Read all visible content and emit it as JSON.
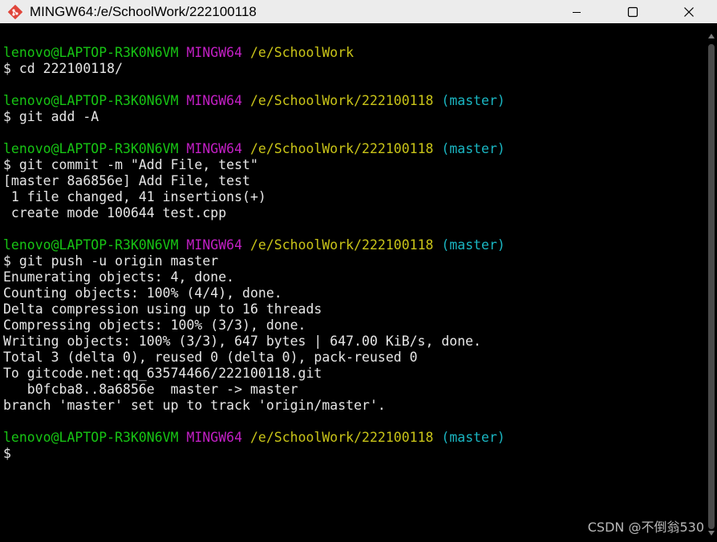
{
  "window": {
    "title": "MINGW64:/e/SchoolWork/222100118",
    "app_icon": "git-bash-icon",
    "controls": [
      {
        "name": "minimize-button",
        "icon": "minimize-icon"
      },
      {
        "name": "maximize-button",
        "icon": "maximize-icon"
      },
      {
        "name": "close-button",
        "icon": "close-icon"
      }
    ]
  },
  "colors": {
    "user_host": "#17c414",
    "system": "#c21fc4",
    "path": "#c9c418",
    "branch": "#1ab6c2",
    "text": "#e6e6e6",
    "background": "#000000"
  },
  "terminal": {
    "lines": [
      {
        "type": "prompt",
        "user": "lenovo@LAPTOP-R3K0N6VM",
        "system": "MINGW64",
        "path": "/e/SchoolWork",
        "branch": ""
      },
      {
        "type": "text",
        "text": "$ cd 222100118/"
      },
      {
        "type": "blank",
        "text": ""
      },
      {
        "type": "prompt",
        "user": "lenovo@LAPTOP-R3K0N6VM",
        "system": "MINGW64",
        "path": "/e/SchoolWork/222100118",
        "branch": "(master)"
      },
      {
        "type": "text",
        "text": "$ git add -A"
      },
      {
        "type": "blank",
        "text": ""
      },
      {
        "type": "prompt",
        "user": "lenovo@LAPTOP-R3K0N6VM",
        "system": "MINGW64",
        "path": "/e/SchoolWork/222100118",
        "branch": "(master)"
      },
      {
        "type": "text",
        "text": "$ git commit -m \"Add File, test\""
      },
      {
        "type": "text",
        "text": "[master 8a6856e] Add File, test"
      },
      {
        "type": "text",
        "text": " 1 file changed, 41 insertions(+)"
      },
      {
        "type": "text",
        "text": " create mode 100644 test.cpp"
      },
      {
        "type": "blank",
        "text": ""
      },
      {
        "type": "prompt",
        "user": "lenovo@LAPTOP-R3K0N6VM",
        "system": "MINGW64",
        "path": "/e/SchoolWork/222100118",
        "branch": "(master)"
      },
      {
        "type": "text",
        "text": "$ git push -u origin master"
      },
      {
        "type": "text",
        "text": "Enumerating objects: 4, done."
      },
      {
        "type": "text",
        "text": "Counting objects: 100% (4/4), done."
      },
      {
        "type": "text",
        "text": "Delta compression using up to 16 threads"
      },
      {
        "type": "text",
        "text": "Compressing objects: 100% (3/3), done."
      },
      {
        "type": "text",
        "text": "Writing objects: 100% (3/3), 647 bytes | 647.00 KiB/s, done."
      },
      {
        "type": "text",
        "text": "Total 3 (delta 0), reused 0 (delta 0), pack-reused 0"
      },
      {
        "type": "text",
        "text": "To gitcode.net:qq_63574466/222100118.git"
      },
      {
        "type": "text",
        "text": "   b0fcba8..8a6856e  master -> master"
      },
      {
        "type": "text",
        "text": "branch 'master' set up to track 'origin/master'."
      },
      {
        "type": "blank",
        "text": ""
      },
      {
        "type": "prompt",
        "user": "lenovo@LAPTOP-R3K0N6VM",
        "system": "MINGW64",
        "path": "/e/SchoolWork/222100118",
        "branch": "(master)"
      },
      {
        "type": "text",
        "text": "$"
      }
    ]
  },
  "watermark": "CSDN @不倒翁530"
}
